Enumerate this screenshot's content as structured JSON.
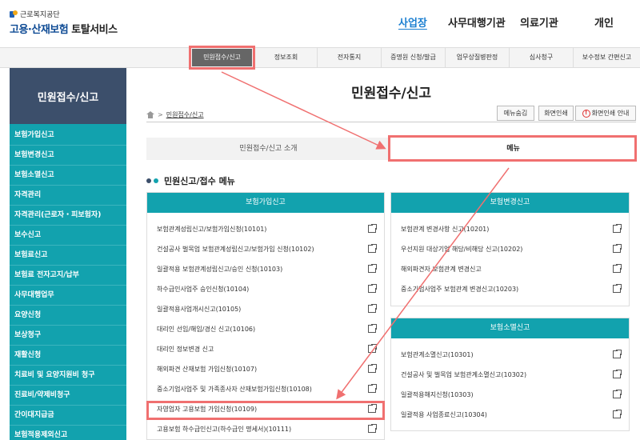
{
  "logo": {
    "org": "근로복지공단",
    "service_colored": "고용·산재보험",
    "service_dark": " 토탈서비스"
  },
  "top_nav": [
    "사업장",
    "사무대행기관",
    "의료기관",
    "개인"
  ],
  "menu_bar": [
    "민원접수/신고",
    "정보조회",
    "전자통지",
    "증명원 신청/발급",
    "업무상질병판정",
    "심사청구",
    "보수정보 간편신고"
  ],
  "sidebar": {
    "title": "민원접수/신고",
    "items": [
      "보험가입신고",
      "보험변경신고",
      "보험소멸신고",
      "자격관리",
      "자격관리(근로자・피보험자)",
      "보수신고",
      "보험료신고",
      "보험료 전자고지/납부",
      "사무대행업무",
      "요양신청",
      "보상청구",
      "재활신청",
      "치료비 및 요양지원비 청구",
      "진료비/약제비청구",
      "간이대지급금",
      "보험적용제외신고"
    ]
  },
  "main": {
    "title": "민원접수/신고",
    "breadcrumb": {
      "sep": ">",
      "current": "민원접수/신고"
    },
    "buttons": {
      "menu_hide": "메뉴숨김",
      "print": "화면인쇄",
      "print_guide": "화면인쇄 안내"
    },
    "tabs": {
      "intro": "민원접수/신고 소개",
      "menu": "메뉴"
    },
    "section_title": "민원신고/접수 메뉴"
  },
  "panels": {
    "join": {
      "title": "보험가입신고",
      "rows": [
        "보험관계성립신고/보험가입신청(10101)",
        "건설공사 벌목업 보험관계성립신고/보험가입 신청(10102)",
        "일괄적용 보험관계성립신고/승인 신청(10103)",
        "하수급인사업주 승인신청(10104)",
        "일괄적용사업개시신고(10105)",
        "대리인 선임/해임/경신 신고(10106)",
        "대리인 정보변경 신고",
        "해외파견 산재보험 가입신청(10107)",
        "중소기업사업주 및 가족종사자 산재보험가입신청(10108)",
        "자영업자 고용보험 가입신청(10109)",
        "고용보험 하수급인신고(하수급인 명세서)(10111)"
      ]
    },
    "change": {
      "title": "보험변경신고",
      "rows": [
        "보험관계 변경사항 신고(10201)",
        "우선지원 대상기업 해당/비해당 신고(10202)",
        "해외파견자 보험관계 변경신고",
        "중소기업사업주 보험관계 변경신고(10203)"
      ]
    },
    "end": {
      "title": "보험소멸신고",
      "rows": [
        "보험관계소멸신고(10301)",
        "건설공사 및 벌목업 보험관계소멸신고(10302)",
        "일괄적용해지신청(10303)",
        "일괄적용 사업종료신고(10304)"
      ]
    }
  },
  "colors": {
    "teal": "#12a2ae",
    "navy": "#3c4f6b",
    "highlight": "#f07070",
    "active_nav": "#1b7fd1"
  }
}
